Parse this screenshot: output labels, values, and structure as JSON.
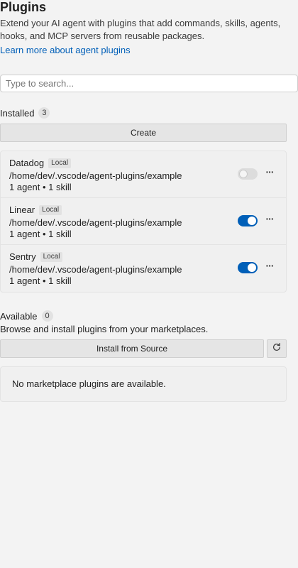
{
  "header": {
    "title": "Plugins",
    "description": "Extend your AI agent with plugins that add commands, skills, agents, hooks, and MCP servers from reusable packages.",
    "learn_more": "Learn more about agent plugins"
  },
  "search": {
    "placeholder": "Type to search...",
    "value": ""
  },
  "installed": {
    "label": "Installed",
    "count": "3",
    "create_label": "Create",
    "plugins": [
      {
        "name": "Datadog",
        "badge": "Local",
        "path": "/home/dev/.vscode/agent-plugins/example",
        "meta": "1 agent • 1 skill",
        "enabled": false
      },
      {
        "name": "Linear",
        "badge": "Local",
        "path": "/home/dev/.vscode/agent-plugins/example",
        "meta": "1 agent • 1 skill",
        "enabled": true
      },
      {
        "name": "Sentry",
        "badge": "Local",
        "path": "/home/dev/.vscode/agent-plugins/example",
        "meta": "1 agent • 1 skill",
        "enabled": true
      }
    ],
    "more_label": "···"
  },
  "available": {
    "label": "Available",
    "count": "0",
    "description": "Browse and install plugins from your marketplaces.",
    "install_label": "Install from Source",
    "empty_message": "No marketplace plugins are available."
  },
  "icons": {
    "refresh": "refresh-icon",
    "more": "more-icon"
  },
  "colors": {
    "accent": "#005fb8",
    "background": "#f3f3f3",
    "link": "#005fb8"
  }
}
